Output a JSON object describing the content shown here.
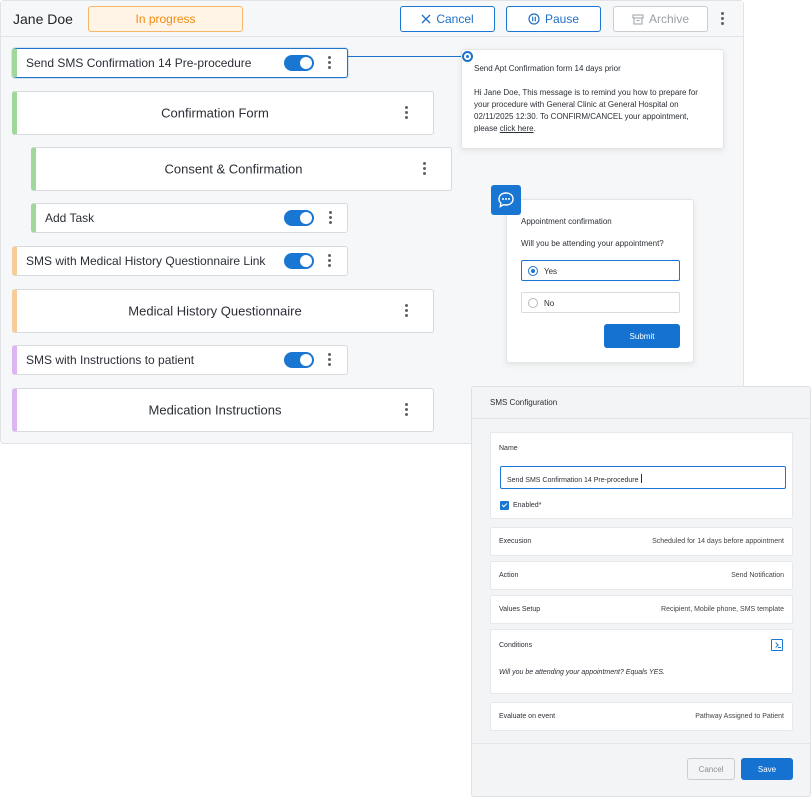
{
  "header": {
    "patient_name": "Jane Doe",
    "status": "In progress",
    "cancel_label": "Cancel",
    "pause_label": "Pause",
    "archive_label": "Archive"
  },
  "workflow": {
    "items": [
      {
        "label": "Send SMS Confirmation 14 Pre-procedure",
        "enabled": true
      },
      {
        "label": "Confirmation Form"
      },
      {
        "label": "Consent & Confirmation"
      },
      {
        "label": "Add Task",
        "enabled": true
      },
      {
        "label": "SMS with Medical History Questionnaire Link",
        "enabled": true
      },
      {
        "label": "Medical History Questionnaire"
      },
      {
        "label": "SMS with Instructions to patient",
        "enabled": true
      },
      {
        "label": "Medication Instructions"
      }
    ]
  },
  "sms_preview": {
    "title": "Send Apt Confirmation form 14 days prior",
    "body": "Hi Jane Doe, This message is to remind you how to prepare for your procedure with General Clinic at General Hospital on 02/11/2025 12:30. To CONFIRM/CANCEL your appointment, please ",
    "link_text": "click here",
    "link_suffix": "."
  },
  "appointment": {
    "title": "Appointment confirmation",
    "question": "Will you be attending your appointment?",
    "options": [
      {
        "label": "Yes",
        "selected": true
      },
      {
        "label": "No",
        "selected": false
      }
    ],
    "submit_label": "Submit"
  },
  "sms_config": {
    "title": "SMS Configuration",
    "name_label": "Name",
    "name_value": "Send SMS Confirmation 14 Pre-procedure",
    "enabled_label": "Enabled*",
    "enabled": true,
    "rows": [
      {
        "key": "Execusion",
        "value": "Scheduled for 14 days before appointment"
      },
      {
        "key": "Action",
        "value": "Send Notification"
      },
      {
        "key": "Values Setup",
        "value": "Recipient, Mobile phone, SMS template"
      },
      {
        "key": "Evaluate on event",
        "value": "Pathway Assigned to Patient"
      }
    ],
    "conditions_label": "Conditions",
    "conditions_text": "Will you be attending your appointment? Equals YES.",
    "cancel_label": "Cancel",
    "save_label": "Save"
  },
  "colors": {
    "primary": "#1976d2",
    "status_orange": "#f08c12",
    "accent_green": "#9fd89a",
    "accent_orange": "#f6cc9a",
    "accent_purple": "#dcb6f1"
  }
}
